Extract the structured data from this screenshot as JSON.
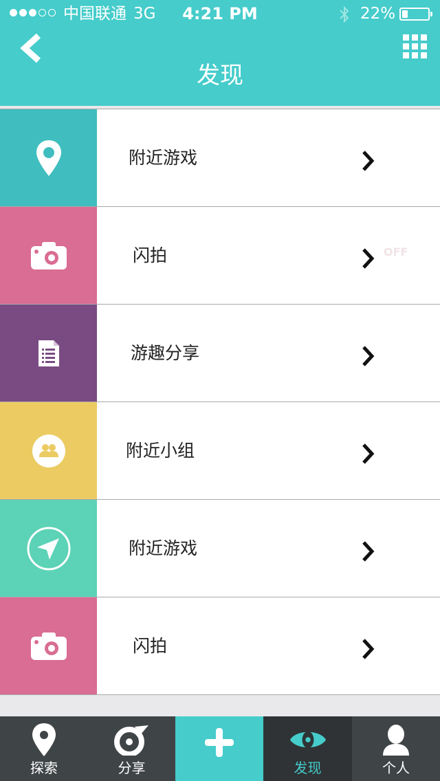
{
  "status_bar": {
    "carrier": "中国联通",
    "network": "3G",
    "time": "4:21 PM",
    "battery_percent": "22%",
    "battery_level": 0.22,
    "signal_bars_filled": 3,
    "signal_bars_total": 5
  },
  "header": {
    "title": "发现",
    "back_icon": "chevron-left-icon",
    "menu_icon": "grid-icon"
  },
  "list_items": [
    {
      "label": "附近游戏",
      "icon": "map-pin-icon",
      "color": "#3fbdbf"
    },
    {
      "label": "闪拍",
      "icon": "camera-icon",
      "color": "#d96d93",
      "tag": "OFF"
    },
    {
      "label": "游趣分享",
      "icon": "document-icon",
      "color": "#7a4b82"
    },
    {
      "label": "附近小组",
      "icon": "group-icon",
      "color": "#ebcb62"
    },
    {
      "label": "附近游戏",
      "icon": "navigation-icon",
      "color": "#5cd2b6"
    },
    {
      "label": "闪拍",
      "icon": "camera-icon",
      "color": "#d96d93"
    }
  ],
  "tab_bar": {
    "tabs": [
      {
        "label": "探索",
        "icon": "map-pin-icon"
      },
      {
        "label": "分享",
        "icon": "share-icon"
      },
      {
        "label": "",
        "icon": "plus-icon"
      },
      {
        "label": "发现",
        "icon": "eye-icon",
        "active": true
      },
      {
        "label": "个人",
        "icon": "user-icon"
      }
    ]
  },
  "colors": {
    "accent": "#45cccb",
    "tab_bar": "#3f4446",
    "tab_active": "#2f3335"
  }
}
